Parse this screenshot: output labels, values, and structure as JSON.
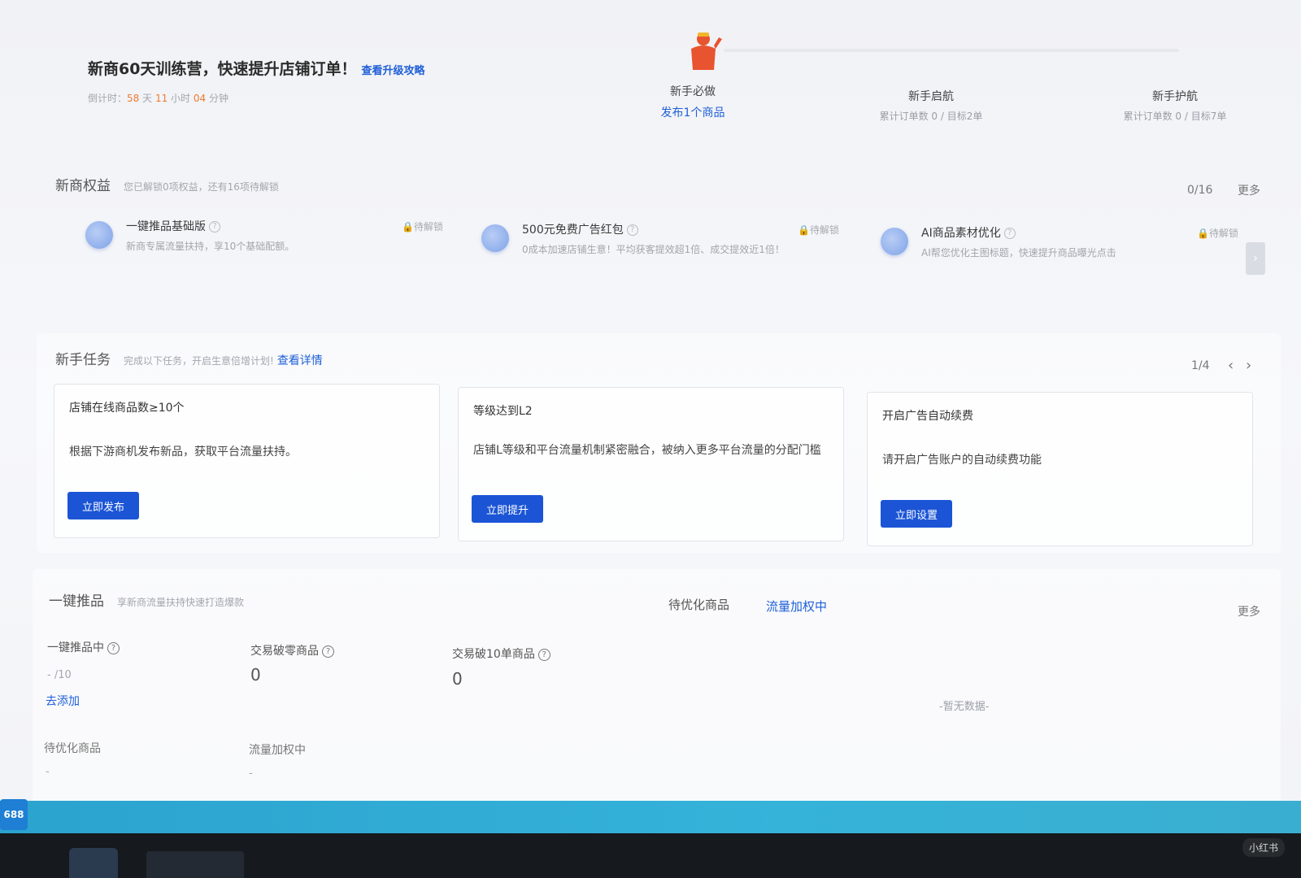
{
  "banner": {
    "title": "新商60天训练营，快速提升店铺订单！",
    "link": "查看升级攻略",
    "countdown": {
      "prefix": "倒计时：",
      "days": "58",
      "days_unit": " 天 ",
      "hours": "11",
      "hours_unit": " 小时 ",
      "minutes": "04",
      "minutes_unit": " 分钟"
    },
    "steps": [
      {
        "title": "新手必做",
        "sub": "发布1个商品"
      },
      {
        "title": "新手启航",
        "sub": "累计订单数 0 / 目标2单"
      },
      {
        "title": "新手护航",
        "sub": "累计订单数 0 / 目标7单"
      }
    ]
  },
  "benefits": {
    "title": "新商权益",
    "subtitle": "您已解锁0项权益，还有16项待解锁",
    "count": "0/16",
    "more": "更多",
    "items": [
      {
        "title": "一键推品基础版",
        "desc": "新商专属流量扶持，享10个基础配额。",
        "status": "待解锁"
      },
      {
        "title": "500元免费广告红包",
        "desc": "0成本加速店铺生意！平均获客提效超1倍、成交提效近1倍！",
        "status": "待解锁"
      },
      {
        "title": "AI商品素材优化",
        "desc": "AI帮您优化主图标题，快速提升商品曝光点击",
        "status": "待解锁"
      }
    ]
  },
  "tasks": {
    "title": "新手任务",
    "subtitle": "完成以下任务，开启生意倍增计划!",
    "link": "查看详情",
    "pager": "1/4",
    "items": [
      {
        "title": "店铺在线商品数≥10个",
        "desc": "根据下游商机发布新品，获取平台流量扶持。",
        "button": "立即发布"
      },
      {
        "title": "等级达到L2",
        "desc": "店铺L等级和平台流量机制紧密融合，被纳入更多平台流量的分配门槛",
        "button": "立即提升"
      },
      {
        "title": "开启广告自动续费",
        "desc": "请开启广告账户的自动续费功能",
        "button": "立即设置"
      }
    ]
  },
  "promo": {
    "title": "一键推品",
    "subtitle": "享新商流量扶持快速打造爆款",
    "tabs": [
      "待优化商品",
      "流量加权中"
    ],
    "more": "更多",
    "stats": [
      {
        "label": "一键推品中",
        "value": "- /10",
        "link": "去添加"
      },
      {
        "label": "交易破零商品",
        "value": "0"
      },
      {
        "label": "交易破10单商品",
        "value": "0"
      }
    ],
    "stats2": [
      {
        "label": "待优化商品",
        "value": "-"
      },
      {
        "label": "流量加权中",
        "value": "-"
      }
    ],
    "empty": "-暂无数据-"
  },
  "taskbar": {
    "logo": "688",
    "watermark": "小红书"
  },
  "colors": {
    "primary": "#1b55d6",
    "link": "#1f5fd8",
    "accent_orange": "#ee7a2f",
    "bottom_strip": "#2ba3cf"
  }
}
